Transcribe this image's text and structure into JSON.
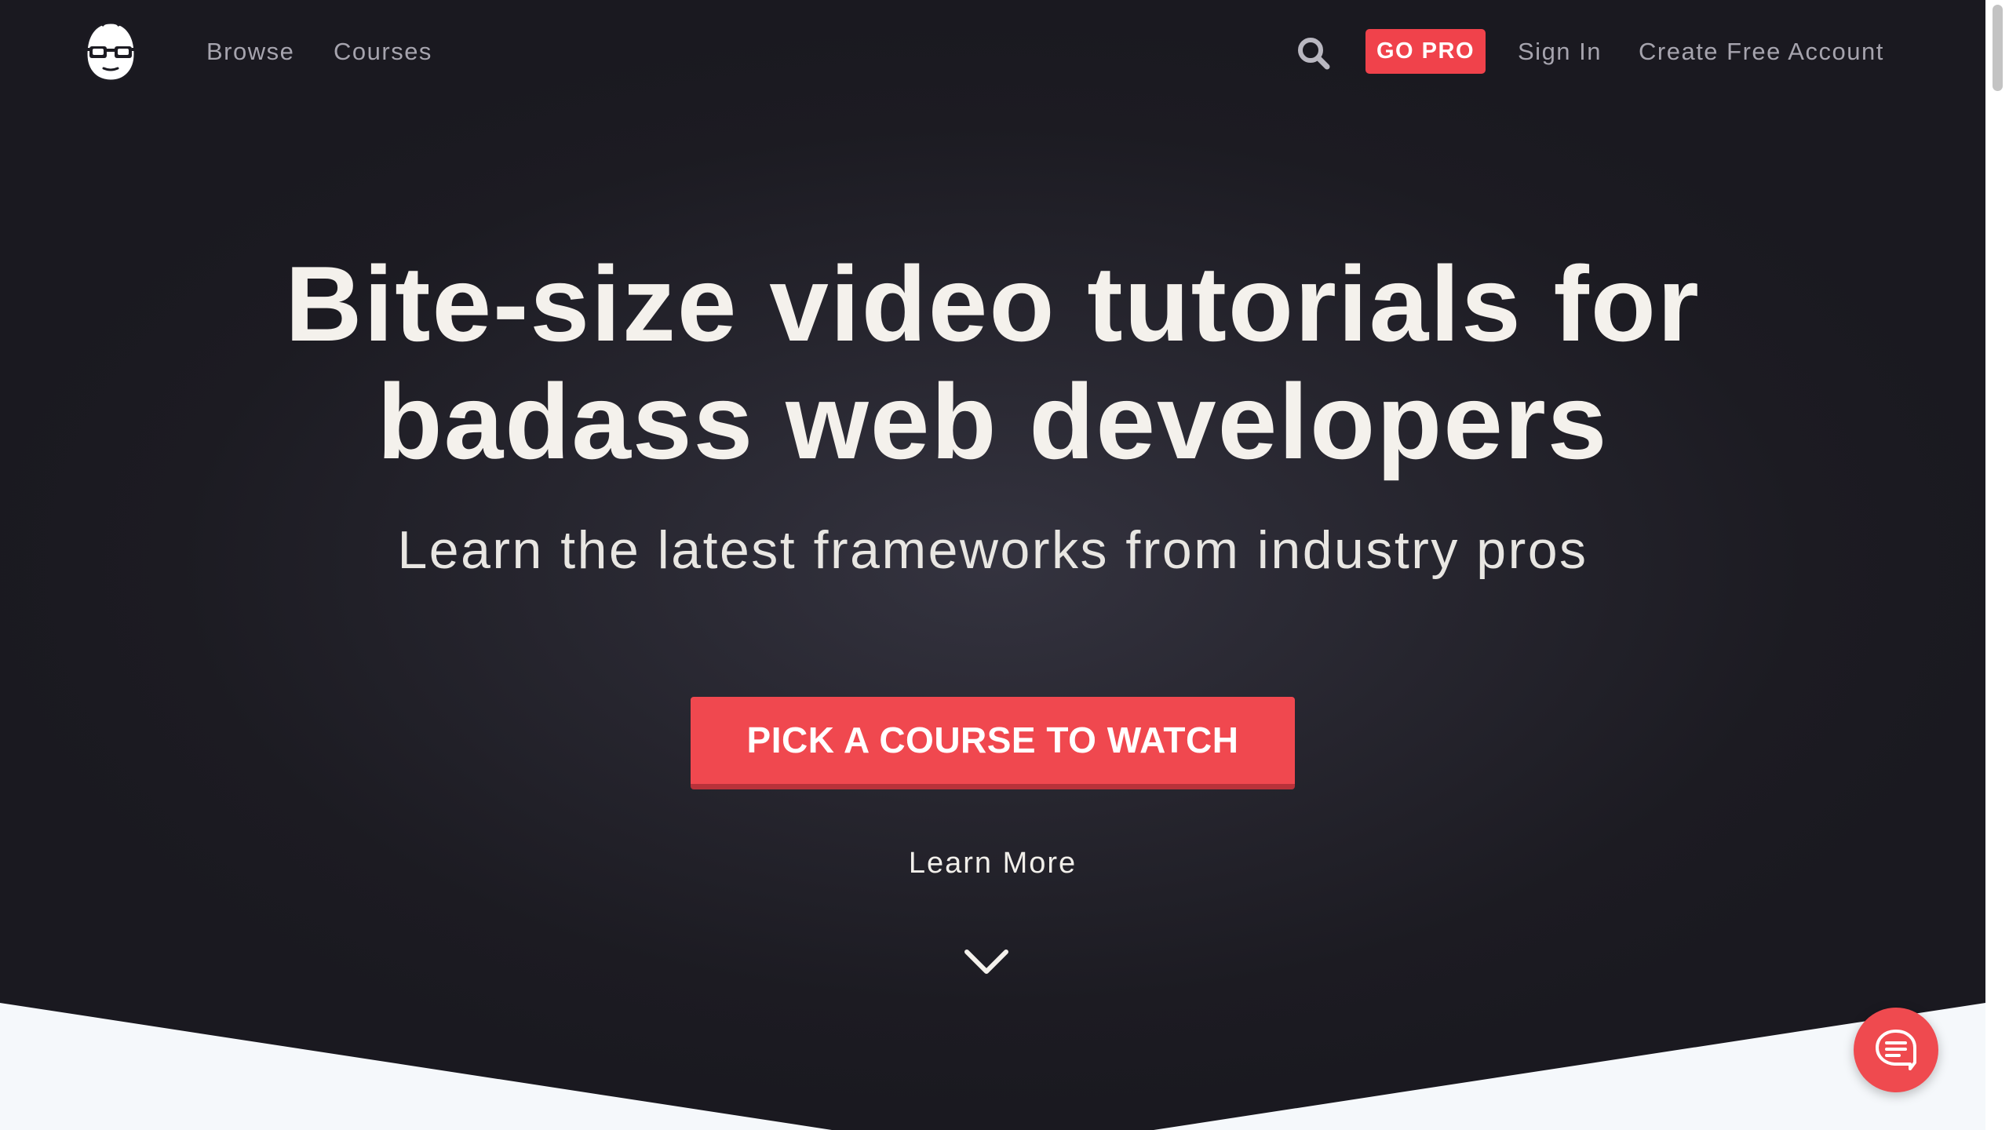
{
  "nav": {
    "logo_icon": "nerd-with-glasses-icon",
    "browse_label": "Browse",
    "courses_label": "Courses",
    "search_icon": "search-icon",
    "gopro_label": "GO PRO",
    "signin_label": "Sign In",
    "create_account_label": "Create Free Account"
  },
  "hero": {
    "title_line1": "Bite-size video tutorials for",
    "title_line2": "badass web developers",
    "subtitle": "Learn the latest frameworks from industry pros",
    "cta_label": "PICK A COURSE TO WATCH",
    "learn_more_label": "Learn More",
    "scroll_icon": "chevron-down-icon"
  },
  "chat": {
    "icon": "chat-bubble-icon"
  },
  "colors": {
    "background": "#1c1b22",
    "accent": "#f0424b",
    "cta": "#f0484f",
    "text_primary": "#f4f1ec",
    "text_muted": "#a6a4ae",
    "wedge": "#f5f8fb"
  }
}
